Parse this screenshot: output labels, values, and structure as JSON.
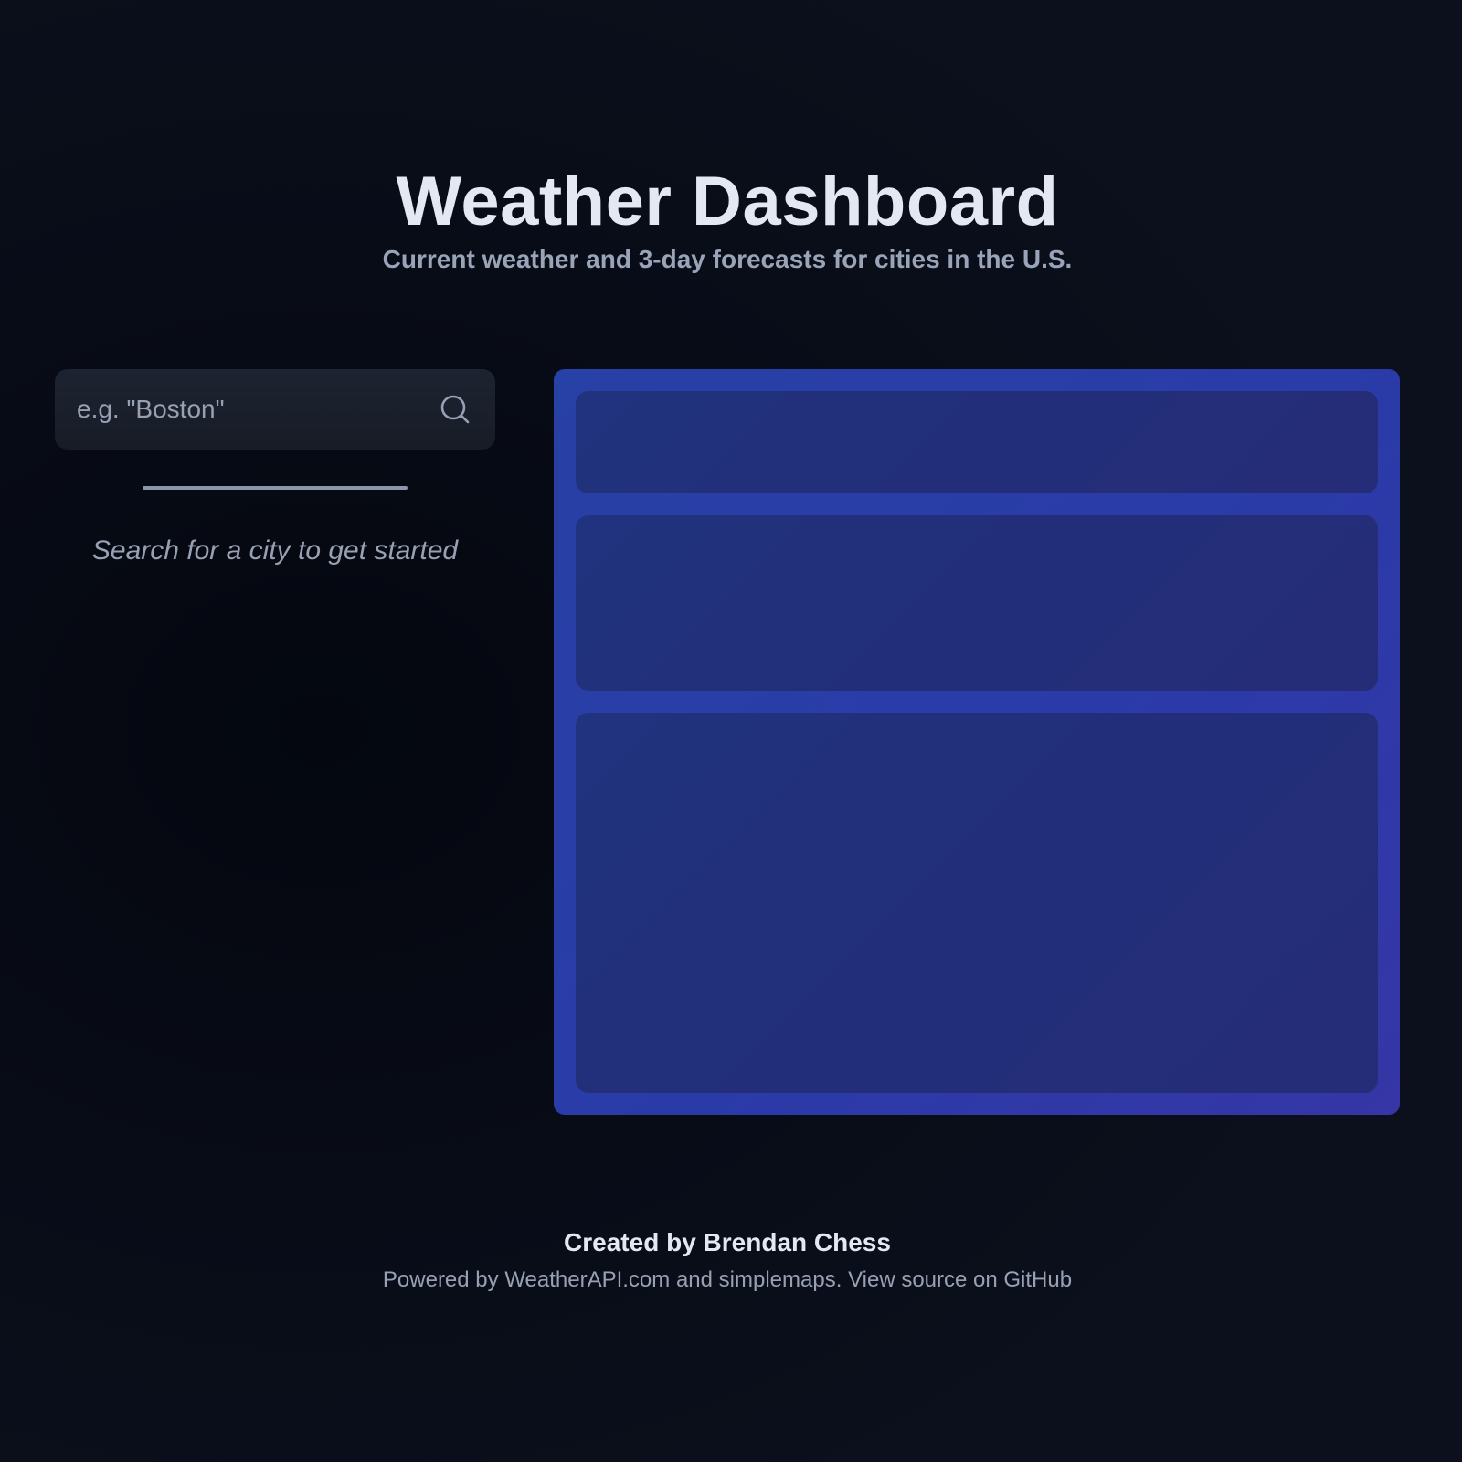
{
  "header": {
    "title": "Weather Dashboard",
    "subtitle": "Current weather and 3-day forecasts for cities in the U.S."
  },
  "search": {
    "placeholder": "e.g. \"Boston\"",
    "value": "",
    "icon": "search-icon"
  },
  "sidebar": {
    "empty_message": "Search for a city to get started"
  },
  "footer": {
    "credit": "Created by Brendan Chess",
    "powered_prefix": "Powered by ",
    "weatherapi_link": "WeatherAPI.com",
    "and_text": " and ",
    "simplemaps_link": "simplemaps",
    "separator": ". ",
    "github_link": "View source on GitHub"
  },
  "colors": {
    "background": "#0a0e18",
    "card_gradient_start": "#2841a6",
    "card_gradient_end": "#3636a6",
    "placeholder_block": "#222e7a",
    "text_primary": "#e4e8f2",
    "text_muted": "#98a1b4"
  }
}
